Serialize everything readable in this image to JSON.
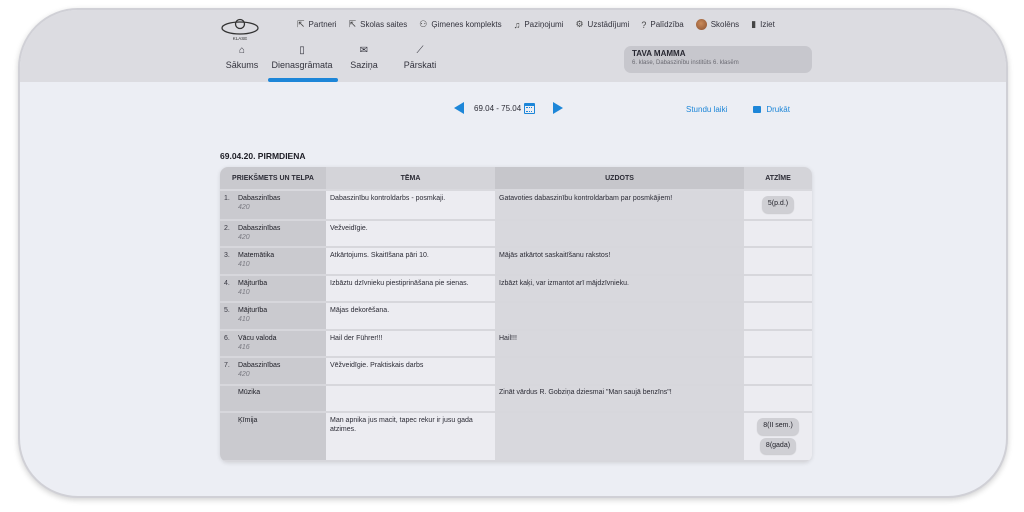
{
  "top": {
    "logo_text": "KLASE",
    "links": [
      {
        "icon": "external-link-icon",
        "glyph": "⇱",
        "label": "Partneri"
      },
      {
        "icon": "external-link-icon",
        "glyph": "⇱",
        "label": "Skolas saites"
      },
      {
        "icon": "family-icon",
        "glyph": "⚇",
        "label": "Ģimenes komplekts"
      },
      {
        "icon": "bell-icon",
        "glyph": "♫",
        "label": "Paziņojumi"
      },
      {
        "icon": "gear-icon",
        "glyph": "⚙",
        "label": "Uzstādījumi"
      },
      {
        "icon": "help-icon",
        "glyph": "?",
        "label": "Palīdzība"
      },
      {
        "icon": "avatar",
        "glyph": "",
        "label": "Skolēns"
      },
      {
        "icon": "logout-icon",
        "glyph": "▮",
        "label": "Iziet"
      }
    ]
  },
  "nav": [
    {
      "icon": "home-icon",
      "glyph": "⌂",
      "label": "Sākums",
      "active": false
    },
    {
      "icon": "diary-icon",
      "glyph": "▯",
      "label": "Dienasgrāmata",
      "active": true
    },
    {
      "icon": "mail-icon",
      "glyph": "✉",
      "label": "Saziņa",
      "active": false
    },
    {
      "icon": "chart-icon",
      "glyph": "⟋",
      "label": "Pārskati",
      "active": false
    }
  ],
  "user": {
    "name": "TAVA MAMMA",
    "subtitle": "6. klase, Dabaszinību institūts 6. klasēm"
  },
  "week": {
    "range": "69.04 - 75.04"
  },
  "actions": {
    "schedule": "Stundu laiki",
    "print": "Drukāt"
  },
  "day": {
    "title": "69.04.20. PIRMDIENA"
  },
  "table": {
    "headers": [
      "PRIEKŠMETS UN TELPA",
      "TĒMA",
      "UZDOTS",
      "ATZĪME"
    ],
    "rows": [
      {
        "num": "1.",
        "subject": "Dabaszinības",
        "room": "420",
        "topic": "Dabaszinību kontroldarbs - posmkaji.",
        "homework": "Gatavoties dabaszinību kontroldarbam par posmkājiem!",
        "grades": [
          "5(p.d.)"
        ]
      },
      {
        "num": "2.",
        "subject": "Dabaszinības",
        "room": "420",
        "topic": "Vežveidīgie.",
        "homework": "",
        "grades": []
      },
      {
        "num": "3.",
        "subject": "Matemātika",
        "room": "410",
        "topic": "Atkārtojums. Skaitīšana pāri 10.",
        "homework": "Mājās atkārtot saskaitīšanu rakstos!",
        "grades": []
      },
      {
        "num": "4.",
        "subject": "Mājturība",
        "room": "410",
        "topic": "Izbāztu dzīvnieku piestiprināšana pie sienas.",
        "homework": "Izbāzt kaķi, var izmantot arī mājdzīvnieku.",
        "grades": []
      },
      {
        "num": "5.",
        "subject": "Mājturība",
        "room": "410",
        "topic": "Mājas dekorēšana.",
        "homework": "",
        "grades": []
      },
      {
        "num": "6.",
        "subject": "Vācu valoda",
        "room": "416",
        "topic": "Hail der Führer!!!",
        "homework": "Hail!!!",
        "grades": []
      },
      {
        "num": "7.",
        "subject": "Dabaszinības",
        "room": "420",
        "topic": "Vēžveidīgie. Praktiskais darbs",
        "homework": "",
        "grades": []
      },
      {
        "num": "",
        "subject": "Mūzika",
        "room": "",
        "topic": "",
        "homework": "Zināt vārdus R. Gobziņa dziesmai \"Man saujā benzīns\"!",
        "grades": []
      },
      {
        "num": "",
        "subject": "Ķīmija",
        "room": "",
        "topic": "Man apnika jus macit, tapec rekur ir jusu gada atzimes.",
        "homework": "",
        "grades": [
          "8(II sem.)",
          "8(gada)"
        ]
      }
    ]
  },
  "colors": {
    "accent": "#1d86d8",
    "topbar": "#dcdce1",
    "page": "#eceef4"
  }
}
